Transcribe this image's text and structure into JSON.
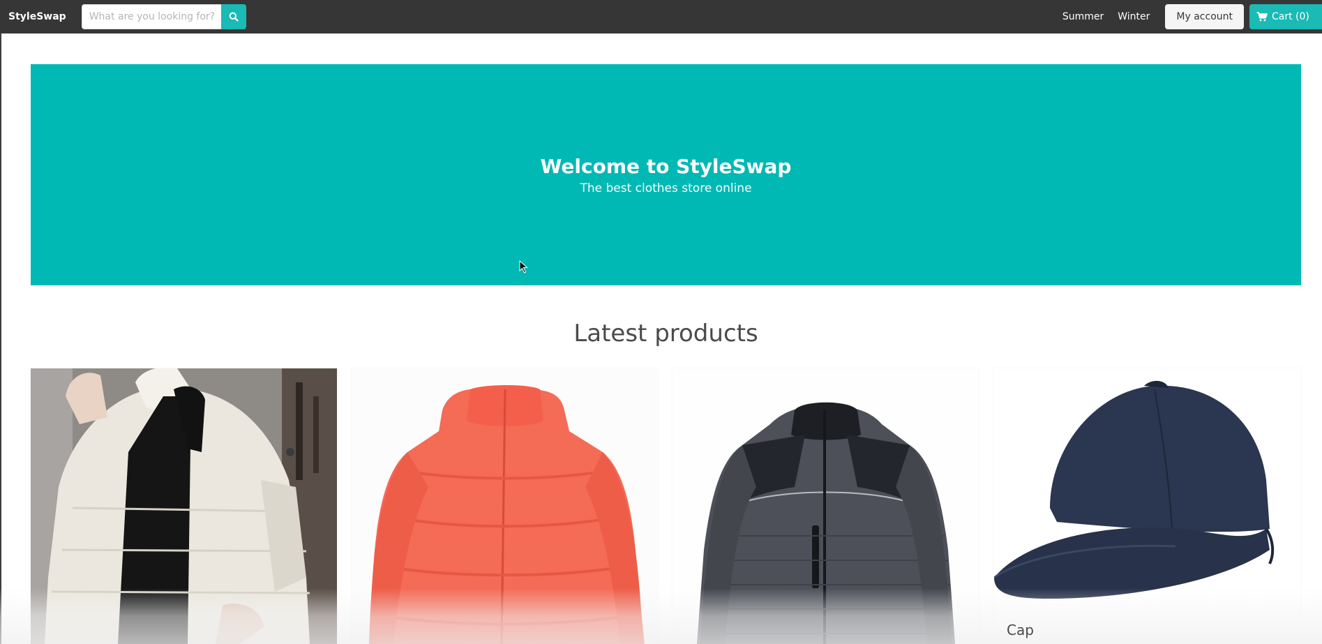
{
  "navbar": {
    "brand": "StyleSwap",
    "search": {
      "placeholder": "What are you looking for?",
      "icon": "search-icon"
    },
    "links": [
      "Summer",
      "Winter"
    ],
    "account_label": "My account",
    "cart_label": "Cart (0)",
    "cart_icon": "shopping-cart-icon"
  },
  "hero": {
    "title": "Welcome to StyleSwap",
    "subtitle": "The best clothes store online"
  },
  "latest": {
    "title": "Latest products",
    "products": [
      {
        "name": "",
        "image": "white-puffer-jacket-image"
      },
      {
        "name": "",
        "image": "red-puffer-jacket-image"
      },
      {
        "name": "",
        "image": "grey-quilted-jacket-image"
      },
      {
        "name": "Cap",
        "image": "navy-baseball-cap-image"
      }
    ]
  },
  "colors": {
    "navbar_bg": "#363636",
    "accent": "#00b9b4",
    "search_button": "#1abab5",
    "text_dark": "#4a4a4a"
  }
}
